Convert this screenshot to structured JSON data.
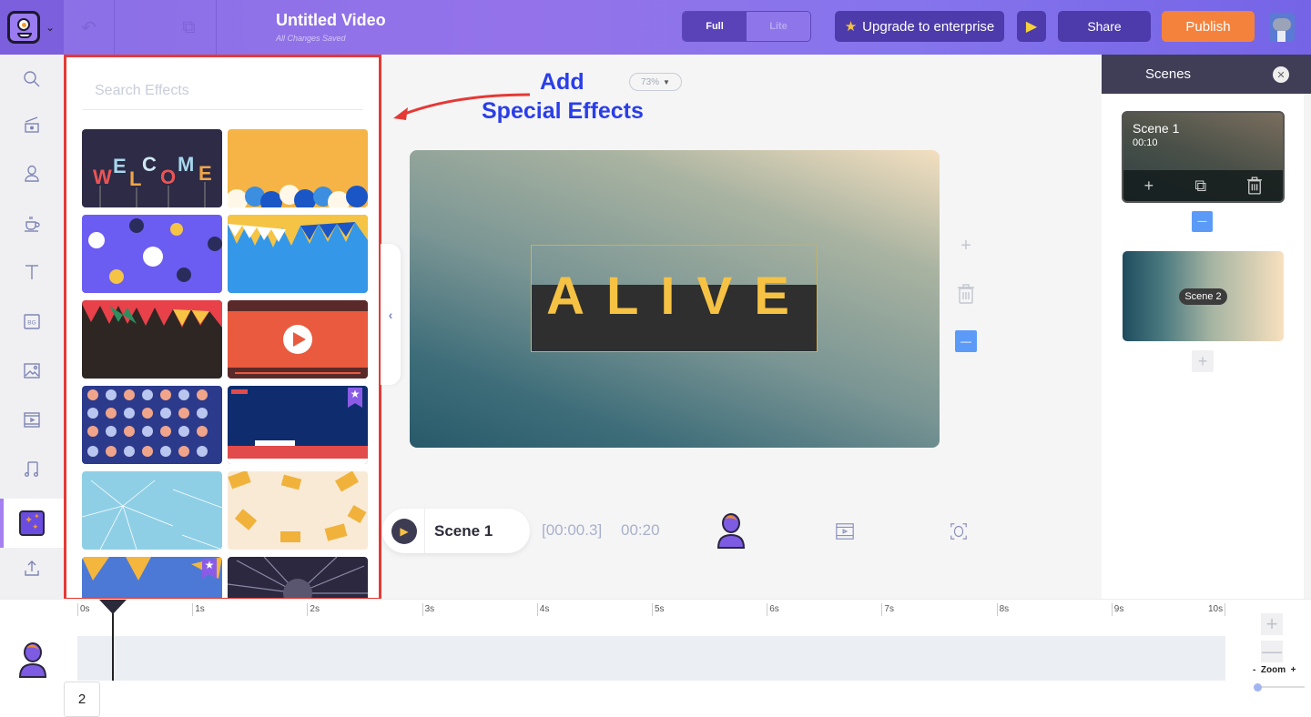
{
  "header": {
    "title": "Untitled Video",
    "save_status": "All Changes Saved",
    "mode_toggle": {
      "options": [
        "Full",
        "Lite"
      ],
      "selected": "Full"
    },
    "upgrade_label": "Upgrade to enterprise",
    "share_label": "Share",
    "publish_label": "Publish",
    "colors": {
      "accent": "#8a6fe6",
      "publish": "#f4823c",
      "dark_button": "#4d3bab"
    }
  },
  "sidebar": {
    "items": [
      {
        "name": "search",
        "icon": "search-icon"
      },
      {
        "name": "templates",
        "icon": "clapperboard-icon"
      },
      {
        "name": "characters",
        "icon": "character-icon"
      },
      {
        "name": "properties",
        "icon": "coffee-cup-icon"
      },
      {
        "name": "text",
        "icon": "text-icon"
      },
      {
        "name": "backgrounds",
        "icon": "bg-icon"
      },
      {
        "name": "images",
        "icon": "image-icon"
      },
      {
        "name": "videos",
        "icon": "film-icon"
      },
      {
        "name": "music",
        "icon": "music-icon"
      },
      {
        "name": "effects",
        "icon": "sparkle-icon",
        "active": true
      },
      {
        "name": "upload",
        "icon": "upload-icon"
      }
    ]
  },
  "effects_panel": {
    "search_placeholder": "Search Effects",
    "thumbnails": [
      {
        "name": "welcome-balloons",
        "premium": false
      },
      {
        "name": "blue-balloons-yellow",
        "premium": false
      },
      {
        "name": "floating-balloons",
        "premium": false
      },
      {
        "name": "bunting-flags-blue",
        "premium": false
      },
      {
        "name": "bunting-flags-dark",
        "premium": false
      },
      {
        "name": "video-player",
        "premium": false
      },
      {
        "name": "polka-dots",
        "premium": false
      },
      {
        "name": "breaking-news",
        "premium": true
      },
      {
        "name": "cracked-glass",
        "premium": false
      },
      {
        "name": "falling-boxes",
        "premium": false
      },
      {
        "name": "pizza-space",
        "premium": true
      },
      {
        "name": "burst-smoke",
        "premium": false
      }
    ]
  },
  "annotation": {
    "line1": "Add",
    "line2": "Special Effects"
  },
  "canvas": {
    "zoom_level": "73%",
    "text": "ALIVE"
  },
  "playback": {
    "scene_name": "Scene 1",
    "current_time": "[00:00.3]",
    "total_time": "00:20"
  },
  "scenes_panel": {
    "title": "Scenes",
    "scenes": [
      {
        "name": "Scene 1",
        "duration": "00:10",
        "selected": true
      },
      {
        "name": "Scene 2"
      }
    ]
  },
  "timeline": {
    "ticks": [
      "0s",
      "1s",
      "2s",
      "3s",
      "4s",
      "5s",
      "6s",
      "7s",
      "8s",
      "9s",
      "10s"
    ],
    "playhead_seconds": 0.3,
    "page_number": "2",
    "zoom_label": "-  Zoom  +",
    "zoom_level": 0.0
  }
}
